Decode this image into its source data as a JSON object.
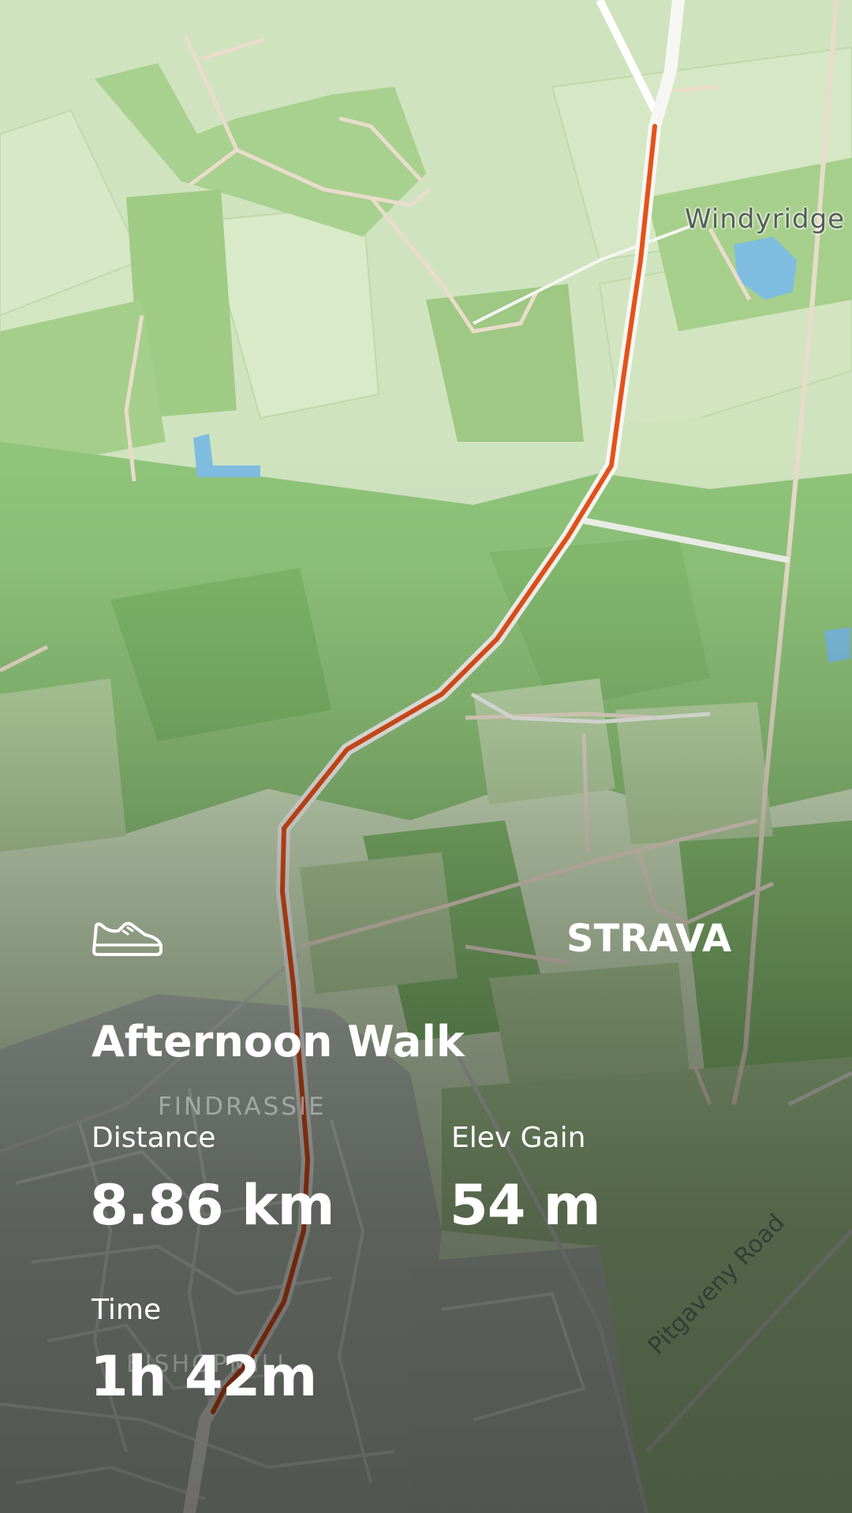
{
  "map": {
    "place_labels": {
      "windyridge": "Windyridge",
      "findrassie": "FINDRASSIE",
      "bishopmill": "BISHOPMILL"
    },
    "road_labels": {
      "pitgaveny_road": "Pitgaveny Road"
    },
    "route_color": "#e4521b",
    "water_color": "#7fbde0",
    "land_color": "#cfe3bf",
    "forest_color": "#8fc47a"
  },
  "activity": {
    "type_icon": "shoe-icon",
    "title": "Afternoon Walk",
    "brand": "STRAVA",
    "stats": {
      "distance_label": "Distance",
      "distance_value": "8.86 km",
      "elev_label": "Elev Gain",
      "elev_value": "54 m",
      "time_label": "Time",
      "time_value": "1h 42m"
    }
  }
}
